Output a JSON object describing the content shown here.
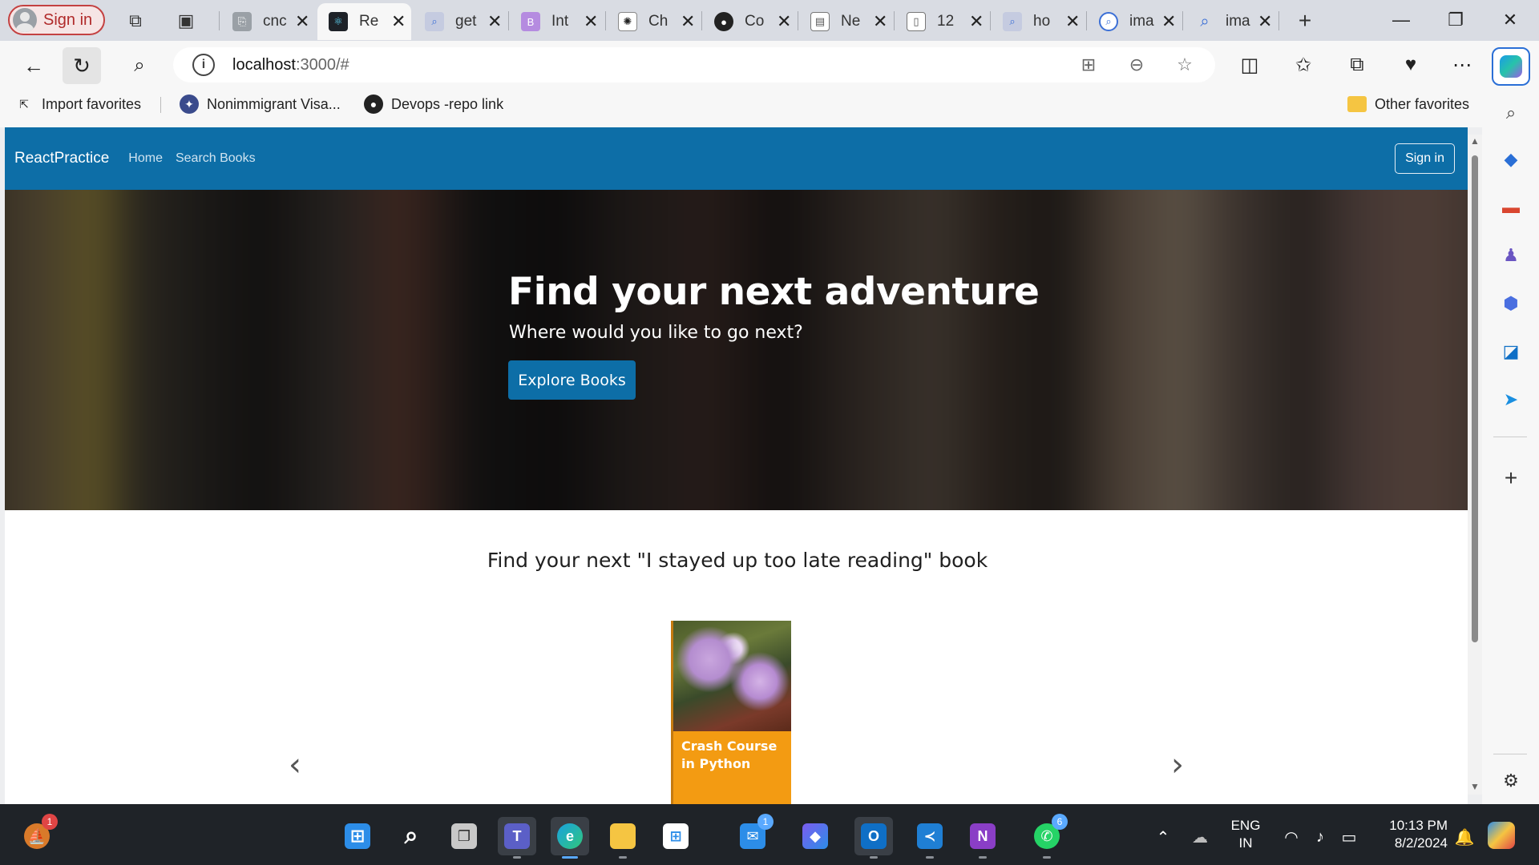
{
  "browser": {
    "signin_label": "Sign in",
    "tabs": [
      {
        "title": "cnc",
        "icon": "document-icon",
        "color": "#9aa0a6"
      },
      {
        "title": "Re",
        "icon": "react-icon",
        "color": "#1e2228",
        "active": true
      },
      {
        "title": "get",
        "icon": "search-icon",
        "color": "#c5cbe0"
      },
      {
        "title": "Int",
        "icon": "bootstrap-icon",
        "color": "#b58be0"
      },
      {
        "title": "Ch",
        "icon": "chatgpt-icon",
        "color": "#222222"
      },
      {
        "title": "Co",
        "icon": "github-icon",
        "color": "#222222"
      },
      {
        "title": "Ne",
        "icon": "page-icon",
        "color": "#9aa0a6"
      },
      {
        "title": "12",
        "icon": "file-icon",
        "color": "#9aa0a6"
      },
      {
        "title": "ho",
        "icon": "search-icon",
        "color": "#c5cbe0"
      },
      {
        "title": "ima",
        "icon": "search-icon",
        "color": "#3b6fd6"
      },
      {
        "title": "ima",
        "icon": "search-icon",
        "color": "#3b6fd6"
      }
    ],
    "address": {
      "host": "localhost",
      "path": ":3000/#"
    },
    "bookmarks": [
      {
        "label": "Import favorites",
        "icon": "import-icon"
      },
      {
        "label": "Nonimmigrant Visa...",
        "icon": "seal-icon"
      },
      {
        "label": "Devops -repo link",
        "icon": "github-icon"
      }
    ],
    "other_favorites": "Other favorites"
  },
  "app": {
    "brand": "ReactPractice",
    "nav_links": [
      "Home",
      "Search Books"
    ],
    "signin": "Sign in",
    "hero": {
      "title": "Find your next adventure",
      "subtitle": "Where would you like to go next?",
      "button": "Explore Books"
    },
    "section_title": "Find your next \"I stayed up too late reading\" book",
    "carousel": {
      "book_title": "Crash Course in Python"
    }
  },
  "taskbar": {
    "badges": {
      "pinned_app": "1",
      "mail": "1",
      "whatsapp": "6"
    },
    "language": {
      "line1": "ENG",
      "line2": "IN"
    },
    "clock": {
      "time": "10:13 PM",
      "date": "8/2/2024"
    }
  },
  "colors": {
    "navbar": "#0d6ea7",
    "primary_button": "#0d6ea7",
    "taskbar": "#1f2328"
  }
}
